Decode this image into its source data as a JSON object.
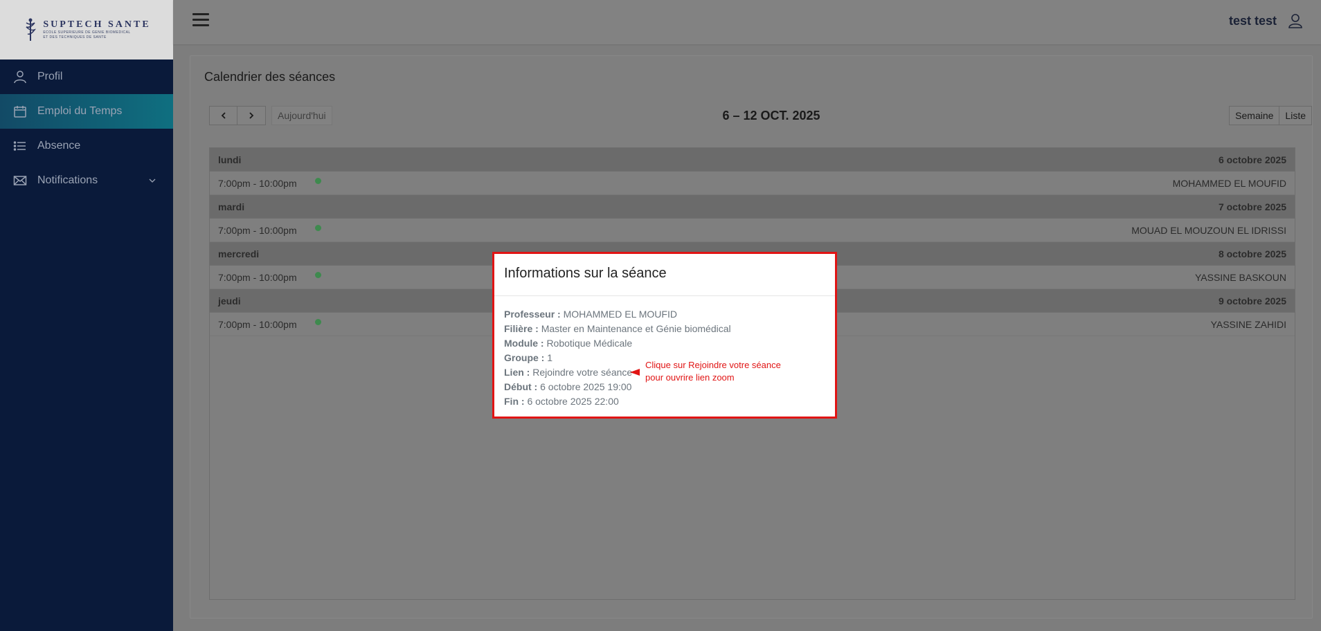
{
  "brand": {
    "name": "SUPTECH SANTE",
    "subtitle_line1": "ECOLE SUPERIEURE DE GENIE BIOMEDICAL",
    "subtitle_line2": "ET DES TECHNIQUES DE SANTE"
  },
  "sidebar": {
    "items": [
      {
        "label": "Profil",
        "icon": "user-icon"
      },
      {
        "label": "Emploi du Temps",
        "icon": "calendar-icon"
      },
      {
        "label": "Absence",
        "icon": "list-icon"
      },
      {
        "label": "Notifications",
        "icon": "envelope-icon"
      }
    ]
  },
  "header": {
    "user_name": "test test"
  },
  "calendar": {
    "title": "Calendrier des séances",
    "today_label": "Aujourd'hui",
    "range_title": "6 – 12 OCT. 2025",
    "view_week": "Semaine",
    "view_list": "Liste",
    "days": [
      {
        "day": "lundi",
        "date": "6 octobre 2025",
        "time": "7:00pm - 10:00pm",
        "professor": "MOHAMMED EL MOUFID"
      },
      {
        "day": "mardi",
        "date": "7 octobre 2025",
        "time": "7:00pm - 10:00pm",
        "professor": "MOUAD EL MOUZOUN EL IDRISSI"
      },
      {
        "day": "mercredi",
        "date": "8 octobre 2025",
        "time": "7:00pm - 10:00pm",
        "professor": "YASSINE BASKOUN"
      },
      {
        "day": "jeudi",
        "date": "9 octobre 2025",
        "time": "7:00pm - 10:00pm",
        "professor": "YASSINE ZAHIDI"
      }
    ],
    "event_color": "#3e8a4e"
  },
  "modal": {
    "title": "Informations sur la séance",
    "professeur_label": "Professeur :",
    "professeur_value": "MOHAMMED EL MOUFID",
    "filiere_label": "Filière :",
    "filiere_value": "Master en Maintenance et Génie biomédical",
    "module_label": "Module :",
    "module_value": "Robotique Médicale",
    "groupe_label": "Groupe :",
    "groupe_value": "1",
    "lien_label": "Lien :",
    "lien_value": "Rejoindre votre séance",
    "debut_label": "Début :",
    "debut_value": "6 octobre 2025 19:00",
    "fin_label": "Fin :",
    "fin_value": "6 octobre 2025 22:00",
    "annotation_line1": "Clique sur Rejoindre votre séance",
    "annotation_line2": "pour ouvrire lien zoom",
    "highlight_color": "#e11414"
  }
}
